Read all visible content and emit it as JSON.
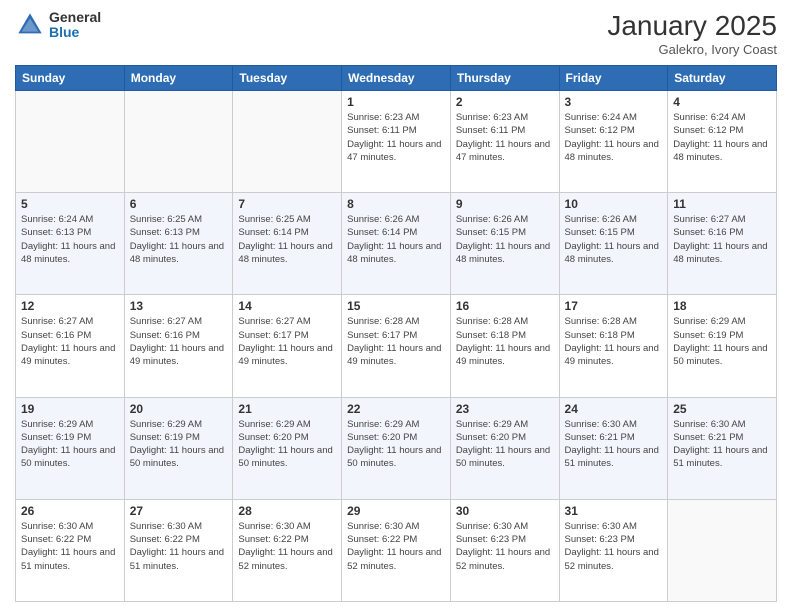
{
  "header": {
    "logo_general": "General",
    "logo_blue": "Blue",
    "month_title": "January 2025",
    "subtitle": "Galekro, Ivory Coast"
  },
  "weekdays": [
    "Sunday",
    "Monday",
    "Tuesday",
    "Wednesday",
    "Thursday",
    "Friday",
    "Saturday"
  ],
  "weeks": [
    [
      {
        "day": null,
        "info": null
      },
      {
        "day": null,
        "info": null
      },
      {
        "day": null,
        "info": null
      },
      {
        "day": "1",
        "info": "Sunrise: 6:23 AM\nSunset: 6:11 PM\nDaylight: 11 hours and 47 minutes."
      },
      {
        "day": "2",
        "info": "Sunrise: 6:23 AM\nSunset: 6:11 PM\nDaylight: 11 hours and 47 minutes."
      },
      {
        "day": "3",
        "info": "Sunrise: 6:24 AM\nSunset: 6:12 PM\nDaylight: 11 hours and 48 minutes."
      },
      {
        "day": "4",
        "info": "Sunrise: 6:24 AM\nSunset: 6:12 PM\nDaylight: 11 hours and 48 minutes."
      }
    ],
    [
      {
        "day": "5",
        "info": "Sunrise: 6:24 AM\nSunset: 6:13 PM\nDaylight: 11 hours and 48 minutes."
      },
      {
        "day": "6",
        "info": "Sunrise: 6:25 AM\nSunset: 6:13 PM\nDaylight: 11 hours and 48 minutes."
      },
      {
        "day": "7",
        "info": "Sunrise: 6:25 AM\nSunset: 6:14 PM\nDaylight: 11 hours and 48 minutes."
      },
      {
        "day": "8",
        "info": "Sunrise: 6:26 AM\nSunset: 6:14 PM\nDaylight: 11 hours and 48 minutes."
      },
      {
        "day": "9",
        "info": "Sunrise: 6:26 AM\nSunset: 6:15 PM\nDaylight: 11 hours and 48 minutes."
      },
      {
        "day": "10",
        "info": "Sunrise: 6:26 AM\nSunset: 6:15 PM\nDaylight: 11 hours and 48 minutes."
      },
      {
        "day": "11",
        "info": "Sunrise: 6:27 AM\nSunset: 6:16 PM\nDaylight: 11 hours and 48 minutes."
      }
    ],
    [
      {
        "day": "12",
        "info": "Sunrise: 6:27 AM\nSunset: 6:16 PM\nDaylight: 11 hours and 49 minutes."
      },
      {
        "day": "13",
        "info": "Sunrise: 6:27 AM\nSunset: 6:16 PM\nDaylight: 11 hours and 49 minutes."
      },
      {
        "day": "14",
        "info": "Sunrise: 6:27 AM\nSunset: 6:17 PM\nDaylight: 11 hours and 49 minutes."
      },
      {
        "day": "15",
        "info": "Sunrise: 6:28 AM\nSunset: 6:17 PM\nDaylight: 11 hours and 49 minutes."
      },
      {
        "day": "16",
        "info": "Sunrise: 6:28 AM\nSunset: 6:18 PM\nDaylight: 11 hours and 49 minutes."
      },
      {
        "day": "17",
        "info": "Sunrise: 6:28 AM\nSunset: 6:18 PM\nDaylight: 11 hours and 49 minutes."
      },
      {
        "day": "18",
        "info": "Sunrise: 6:29 AM\nSunset: 6:19 PM\nDaylight: 11 hours and 50 minutes."
      }
    ],
    [
      {
        "day": "19",
        "info": "Sunrise: 6:29 AM\nSunset: 6:19 PM\nDaylight: 11 hours and 50 minutes."
      },
      {
        "day": "20",
        "info": "Sunrise: 6:29 AM\nSunset: 6:19 PM\nDaylight: 11 hours and 50 minutes."
      },
      {
        "day": "21",
        "info": "Sunrise: 6:29 AM\nSunset: 6:20 PM\nDaylight: 11 hours and 50 minutes."
      },
      {
        "day": "22",
        "info": "Sunrise: 6:29 AM\nSunset: 6:20 PM\nDaylight: 11 hours and 50 minutes."
      },
      {
        "day": "23",
        "info": "Sunrise: 6:29 AM\nSunset: 6:20 PM\nDaylight: 11 hours and 50 minutes."
      },
      {
        "day": "24",
        "info": "Sunrise: 6:30 AM\nSunset: 6:21 PM\nDaylight: 11 hours and 51 minutes."
      },
      {
        "day": "25",
        "info": "Sunrise: 6:30 AM\nSunset: 6:21 PM\nDaylight: 11 hours and 51 minutes."
      }
    ],
    [
      {
        "day": "26",
        "info": "Sunrise: 6:30 AM\nSunset: 6:22 PM\nDaylight: 11 hours and 51 minutes."
      },
      {
        "day": "27",
        "info": "Sunrise: 6:30 AM\nSunset: 6:22 PM\nDaylight: 11 hours and 51 minutes."
      },
      {
        "day": "28",
        "info": "Sunrise: 6:30 AM\nSunset: 6:22 PM\nDaylight: 11 hours and 52 minutes."
      },
      {
        "day": "29",
        "info": "Sunrise: 6:30 AM\nSunset: 6:22 PM\nDaylight: 11 hours and 52 minutes."
      },
      {
        "day": "30",
        "info": "Sunrise: 6:30 AM\nSunset: 6:23 PM\nDaylight: 11 hours and 52 minutes."
      },
      {
        "day": "31",
        "info": "Sunrise: 6:30 AM\nSunset: 6:23 PM\nDaylight: 11 hours and 52 minutes."
      },
      {
        "day": null,
        "info": null
      }
    ]
  ]
}
